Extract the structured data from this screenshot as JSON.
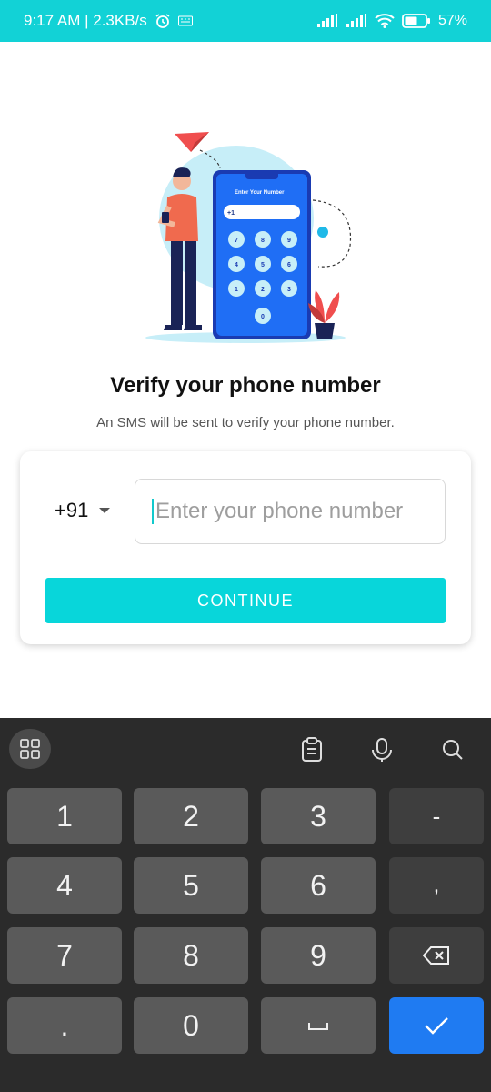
{
  "status_bar": {
    "time_speed": "9:17 AM | 2.3KB/s",
    "battery": "57"
  },
  "hero": {
    "screen_title": "Enter Your Number",
    "screen_prefix": "+1",
    "pad_keys": [
      "7",
      "8",
      "9",
      "4",
      "5",
      "6",
      "1",
      "2",
      "3",
      "0"
    ]
  },
  "page": {
    "title": "Verify your phone number",
    "subtitle": "An SMS will be sent to verify your phone number."
  },
  "form": {
    "country_code": "+91",
    "phone_placeholder": "Enter your phone number",
    "phone_value": "",
    "continue_label": "CONTINUE"
  },
  "keyboard": {
    "rows": [
      [
        "1",
        "2",
        "3",
        "-"
      ],
      [
        "4",
        "5",
        "6",
        ","
      ],
      [
        "7",
        "8",
        "9",
        ""
      ],
      [
        ".",
        "0",
        "",
        ""
      ]
    ]
  },
  "colors": {
    "accent": "#08d6da",
    "status_bar": "#12d2d6",
    "keyboard_bg": "#2b2b2b",
    "done_key": "#1f7bf2"
  }
}
